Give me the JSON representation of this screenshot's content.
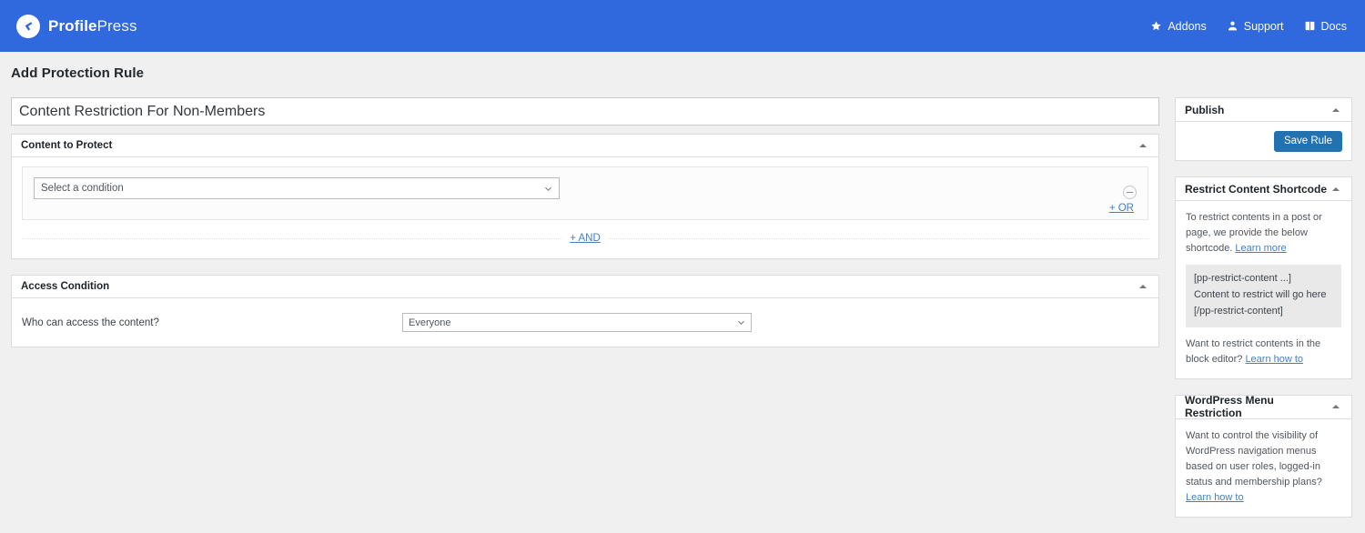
{
  "brand": {
    "name_bold": "Profile",
    "name_light": "Press",
    "logo_icon": "profilepress-arrow-badge-icon"
  },
  "topnav": {
    "items": [
      {
        "label": "Addons",
        "icon": "star-icon"
      },
      {
        "label": "Support",
        "icon": "user-icon"
      },
      {
        "label": "Docs",
        "icon": "book-icon"
      }
    ]
  },
  "page": {
    "title": "Add Protection Rule",
    "rule_title_value": "Content Restriction For Non-Members",
    "rule_title_placeholder": "Enter rule title here"
  },
  "content_to_protect": {
    "heading": "Content to Protect",
    "collapse_icon": "caret-up-icon",
    "condition_select_value": "Select a condition",
    "condition_select_icon": "chevron-down-icon",
    "remove_condition_icon": "minus-circle-icon",
    "or_link": "+ OR",
    "and_link": "+ AND"
  },
  "access_condition": {
    "heading": "Access Condition",
    "collapse_icon": "caret-up-icon",
    "question_label": "Who can access the content?",
    "access_select_value": "Everyone",
    "access_select_icon": "chevron-down-icon"
  },
  "sidebar": {
    "publish": {
      "heading": "Publish",
      "collapse_icon": "caret-up-icon",
      "save_button": "Save Rule"
    },
    "shortcode": {
      "heading": "Restrict Content Shortcode",
      "collapse_icon": "caret-up-icon",
      "intro_text": "To restrict contents in a post or page, we provide the below shortcode. ",
      "intro_link": "Learn more",
      "code_line_1": "[pp-restrict-content ...]",
      "code_line_2": "Content to restrict will go here",
      "code_line_3": "[/pp-restrict-content]",
      "outro_text": "Want to restrict contents in the block editor? ",
      "outro_link": "Learn how to"
    },
    "menu_restriction": {
      "heading": "WordPress Menu Restriction",
      "collapse_icon": "caret-up-icon",
      "text": "Want to control the visibility of WordPress navigation menus based on user roles, logged-in status and membership plans? ",
      "link": "Learn how to"
    }
  },
  "colors": {
    "header_blue": "#3069dd",
    "button_blue": "#2271b1",
    "link_blue": "#4a7ebb",
    "page_bg": "#f0f0f1"
  }
}
